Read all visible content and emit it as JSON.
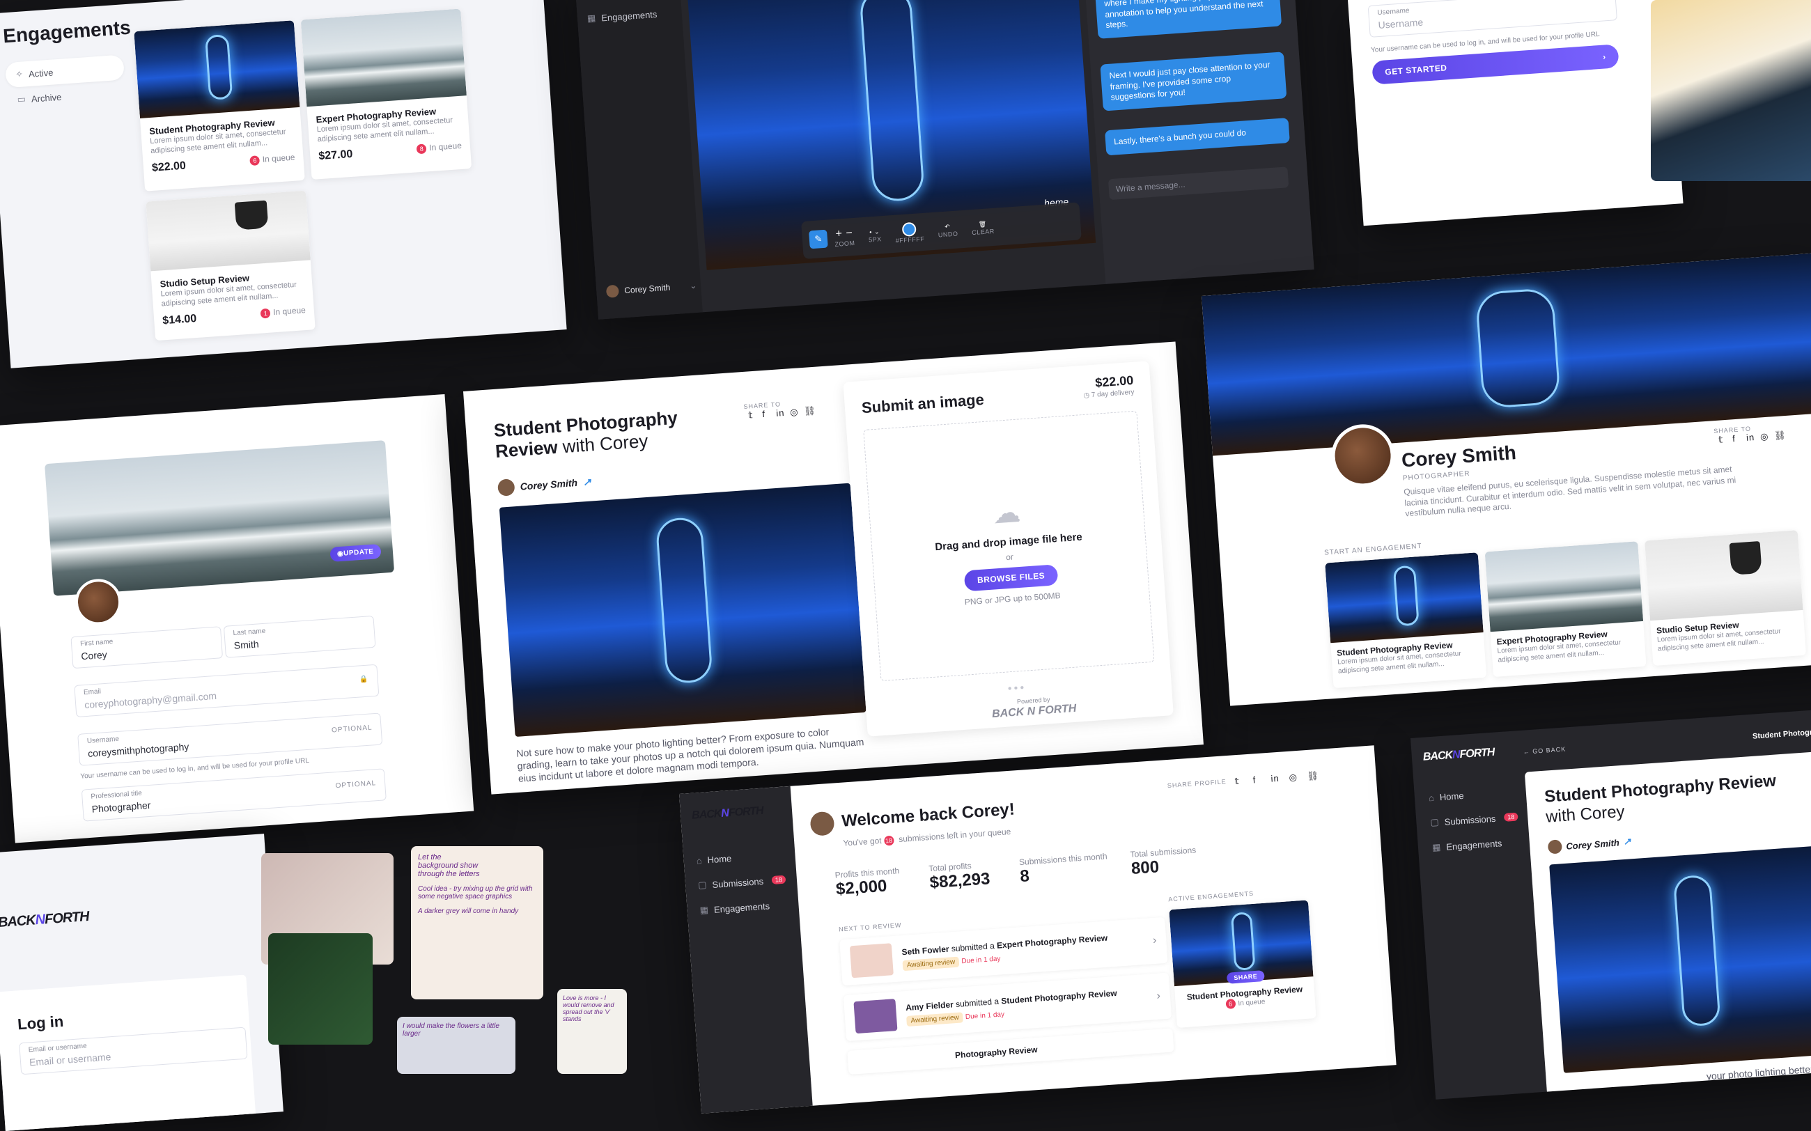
{
  "engagements": {
    "title": "Engagements",
    "nav": [
      {
        "label": "Active",
        "icon": "sparkle-icon"
      },
      {
        "label": "Archive",
        "icon": "archive-icon"
      }
    ],
    "cards": [
      {
        "title": "Student Photography Review",
        "desc": "Lorem ipsum dolor sit amet, consectetur adipiscing sete ament elit nullam...",
        "price": "22.00",
        "queue_count": "6",
        "queue_label": "In queue",
        "photo": "hotel"
      },
      {
        "title": "Expert Photography Review",
        "desc": "Lorem ipsum dolor sit amet, consectetur adipiscing sete ament elit nullam...",
        "price": "27.00",
        "queue_count": "8",
        "queue_label": "In queue",
        "photo": "beach"
      },
      {
        "title": "Studio Setup Review",
        "desc": "Lorem ipsum dolor sit amet, consectetur adipiscing sete ament elit nullam...",
        "price": "14.00",
        "queue_count": "1",
        "queue_label": "In queue",
        "photo": "studio"
      }
    ]
  },
  "annotator": {
    "nav_label": "Engagements",
    "user_name": "Corey Smith",
    "toolbar": {
      "zoom": "ZOOM",
      "size": "5PX",
      "color": "#FFFFFF",
      "undo": "UNDO",
      "clear": "CLEAR"
    },
    "scheme_text": "heme",
    "messages": [
      "As you mentioned, so much of where you can improve is in the post-editing, and this is where I make my lighting pop. I've left some annotation to help you understand the next steps.",
      "Next I would just pay close attention to your framing. I've provided some crop suggestions for you!",
      "Lastly, there's a bunch you could do"
    ],
    "message_placeholder": "Write a message..."
  },
  "username_form": {
    "label": "Username",
    "placeholder": "Username",
    "help": "Your username can be used to log in, and will be used for your profile URL",
    "cta": "GET STARTED"
  },
  "profile_edit": {
    "update_label": "UPDATE",
    "first_name": {
      "label": "First name",
      "value": "Corey"
    },
    "last_name": {
      "label": "Last name",
      "value": "Smith"
    },
    "email": {
      "label": "Email",
      "value": "coreyphotography@gmail.com"
    },
    "username": {
      "label": "Username",
      "optional": "OPTIONAL",
      "value": "coreysmithphotography",
      "help": "Your username can be used to log in, and will be used for your profile URL"
    },
    "title": {
      "label": "Professional title",
      "optional": "OPTIONAL",
      "value": "Photographer"
    }
  },
  "listing": {
    "title": "Student Photography Review",
    "title_suffix": "with Corey",
    "share_label": "SHARE TO",
    "author": "Corey Smith",
    "description": "Not sure how to make your photo lighting better? From exposure to color grading, learn to take your photos up a notch qui dolorem ipsum quia. Numquam eius incidunt ut labore et dolore magnam modi tempora.",
    "submit": {
      "title": "Submit an image",
      "price": "22.00",
      "delivery": "7 day delivery",
      "drop_text": "Drag and drop image file here",
      "or": "or",
      "browse": "BROWSE FILES",
      "hint": "PNG or JPG up to 500MB",
      "powered_by": "Powered by"
    }
  },
  "profile_public": {
    "share_label": "SHARE TO",
    "name": "Corey Smith",
    "role": "PHOTOGRAPHER",
    "bio": "Quisque vitae eleifend purus, eu scelerisque ligula. Suspendisse molestie metus sit amet lacinia tincidunt. Curabitur et interdum odio. Sed mattis velit in sem volutpat, nec varius mi vestibulum nulla neque arcu.",
    "section_label": "START AN ENGAGEMENT",
    "cards": [
      {
        "title": "Student Photography Review",
        "desc": "Lorem ipsum dolor sit amet, consectetur adipiscing sete ament elit nullam...",
        "photo": "hotel"
      },
      {
        "title": "Expert Photography Review",
        "desc": "Lorem ipsum dolor sit amet, consectetur adipiscing sete ament elit nullam...",
        "photo": "beach"
      },
      {
        "title": "Studio Setup Review",
        "desc": "Lorem ipsum dolor sit amet, consectetur adipiscing sete ament elit nullam...",
        "photo": "studio"
      }
    ]
  },
  "login": {
    "logo": "BACK",
    "logo_mark": "N",
    "logo_end": "FORTH",
    "title": "Log in",
    "field_label": "Email or username",
    "placeholder": "Email or username"
  },
  "artwork_notes": [
    "Let the background show through the letters",
    "Cool idea - try mixing up the grid with some negative space graphics",
    "A darker grey will come in handy",
    "I would make the flowers a little larger",
    "Love is more - I would remove and spread out the 'v' stands"
  ],
  "dashboard": {
    "logo": "BACK",
    "logo_mark": "N",
    "logo_end": "FORTH",
    "nav": [
      {
        "label": "Home",
        "icon": "home-icon",
        "count": ""
      },
      {
        "label": "Submissions",
        "icon": "inbox-icon",
        "count": "18"
      },
      {
        "label": "Engagements",
        "icon": "grid-icon",
        "count": ""
      }
    ],
    "welcome": "Welcome back Corey!",
    "queue_prefix": "You've got",
    "queue_count": "18",
    "queue_suffix": "submissions left in your queue",
    "share_profile": "SHARE PROFILE",
    "stats": [
      {
        "label": "Profits this month",
        "value": "2,000",
        "prefix": "$"
      },
      {
        "label": "Total profits",
        "value": "82,293",
        "prefix": "$"
      },
      {
        "label": "Submissions this month",
        "value": "8",
        "prefix": ""
      },
      {
        "label": "Total submissions",
        "value": "800",
        "prefix": ""
      }
    ],
    "next_label": "NEXT TO REVIEW",
    "reviews": [
      {
        "name": "Seth Fowler",
        "verb": "submitted a",
        "item": "Expert Photography Review",
        "status": "Awaiting review",
        "due": "Due in 1 day"
      },
      {
        "name": "Amy Fielder",
        "verb": "submitted a",
        "item": "Student Photography Review",
        "status": "Awaiting review",
        "due": "Due in 1 day"
      },
      {
        "name": "",
        "verb": "",
        "item": "Photography Review",
        "status": "",
        "due": ""
      }
    ],
    "active_label": "ACTIVE ENGAGEMENTS",
    "active_card": {
      "title": "Student Photography Review",
      "share": "SHARE",
      "queue_count": "6",
      "queue_label": "In queue"
    }
  },
  "detail": {
    "logo": "BACK",
    "logo_mark": "N",
    "logo_end": "FORTH",
    "back": "GO BACK",
    "top_right": "Student Photogr",
    "nav": [
      {
        "label": "Home",
        "count": ""
      },
      {
        "label": "Submissions",
        "count": "18"
      },
      {
        "label": "Engagements",
        "count": ""
      }
    ],
    "title": "Student Photography Review",
    "suffix": "with Corey",
    "author": "Corey Smith",
    "tail_text": "your photo lighting better?"
  }
}
